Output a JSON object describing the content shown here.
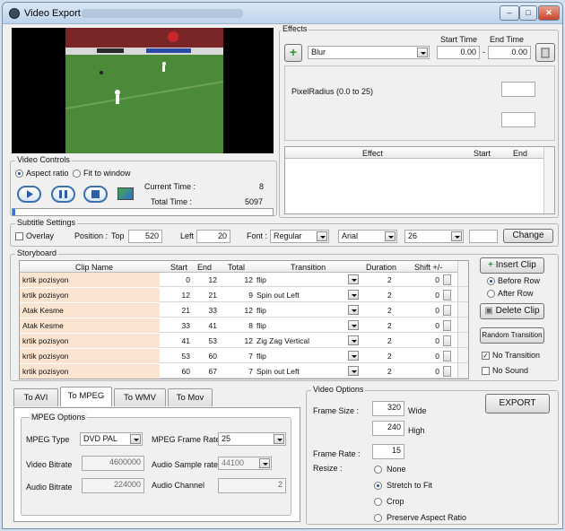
{
  "window": {
    "title": "Video Export",
    "minimize": "–",
    "maximize": "□",
    "close": "✕"
  },
  "effects": {
    "legend": "Effects",
    "add_icon": "+",
    "effect_value": "Blur",
    "start_time_label": "Start Time",
    "end_time_label": "End Time",
    "start_time": "0.00",
    "end_time": "0.00",
    "time_sep": "-",
    "param_label": "PixelRadius (0.0 to 25)",
    "param_value": "",
    "param_value2": "",
    "table_headers": [
      "Effect",
      "Start",
      "End"
    ]
  },
  "video_controls": {
    "legend": "Video Controls",
    "aspect_ratio": "Aspect ratio",
    "fit_to_window": "Fit to window",
    "current_time_label": "Current Time :",
    "current_time": "8",
    "total_time_label": "Total Time :",
    "total_time": "5097",
    "progress": 0.01
  },
  "subtitle": {
    "legend": "Subtitle Settings",
    "overlay": "Overlay",
    "position_label": "Position :",
    "top_label": "Top",
    "top_value": "520",
    "left_label": "Left",
    "left_value": "20",
    "font_label": "Font :",
    "style_value": "Regular",
    "font_value": "Arial",
    "size_value": "26",
    "color_value": "",
    "change": "Change"
  },
  "storyboard": {
    "legend": "Storyboard",
    "headers": [
      "Clip Name",
      "Start",
      "End",
      "Total",
      "Transition",
      "Duration",
      "Shift +/-"
    ],
    "rows": [
      [
        "krtik pozisyon",
        "0",
        "12",
        "12",
        "flip",
        "2",
        "0"
      ],
      [
        "krtik pozisyon",
        "12",
        "21",
        "9",
        "Spin out Left",
        "2",
        "0"
      ],
      [
        "Atak Kesme",
        "21",
        "33",
        "12",
        "flip",
        "2",
        "0"
      ],
      [
        "Atak Kesme",
        "33",
        "41",
        "8",
        "flip",
        "2",
        "0"
      ],
      [
        "krtik pozisyon",
        "41",
        "53",
        "12",
        "Zig Zag Vertical",
        "2",
        "0"
      ],
      [
        "krtik pozisyon",
        "53",
        "60",
        "7",
        "flip",
        "2",
        "0"
      ],
      [
        "krtik pozisyon",
        "60",
        "67",
        "7",
        "Spin out Left",
        "2",
        "0"
      ]
    ],
    "insert_clip": "Insert Clip",
    "before_row": "Before Row",
    "after_row": "After Row",
    "delete_clip": "Delete Clip",
    "random_transition": "Random Transition",
    "no_transition": "No Transition",
    "no_sound": "No Sound"
  },
  "tabs": [
    "To AVI",
    "To MPEG",
    "To WMV",
    "To Mov"
  ],
  "mpeg": {
    "legend": "MPEG Options",
    "type_label": "MPEG Type",
    "type_value": "DVD PAL",
    "frame_rate_label": "MPEG Frame Rate",
    "frame_rate_value": "25",
    "video_bitrate_label": "Video Bitrate",
    "video_bitrate_value": "4600000",
    "sample_rate_label": "Audio Sample rate",
    "sample_rate_value": "44100",
    "audio_bitrate_label": "Audio Bitrate",
    "audio_bitrate_value": "224000",
    "audio_channel_label": "Audio Channel",
    "audio_channel_value": "2"
  },
  "video_options": {
    "legend": "Video Options",
    "frame_size_label": "Frame Size :",
    "width_value": "320",
    "wide_label": "Wide",
    "height_value": "240",
    "high_label": "High",
    "frame_rate_label": "Frame Rate :",
    "frame_rate_value": "15",
    "resize_label": "Resize :",
    "resize_options": [
      "None",
      "Stretch to Fit",
      "Crop",
      "Preserve Aspect Ratio"
    ],
    "export": "EXPORT"
  }
}
